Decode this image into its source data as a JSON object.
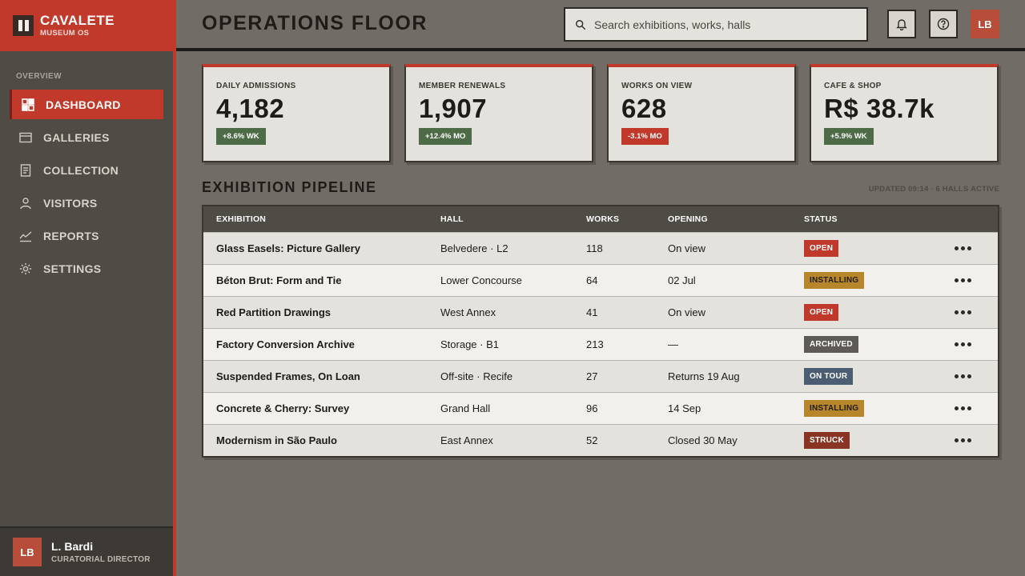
{
  "brand": {
    "name": "CAVALETE",
    "sub": "MUSEUM OS"
  },
  "sidebar": {
    "section_label": "OVERVIEW",
    "items": [
      {
        "label": "DASHBOARD",
        "icon": "dashboard-icon",
        "active": true
      },
      {
        "label": "GALLERIES",
        "icon": "galleries-icon",
        "active": false
      },
      {
        "label": "COLLECTION",
        "icon": "collection-icon",
        "active": false
      },
      {
        "label": "VISITORS",
        "icon": "visitors-icon",
        "active": false
      },
      {
        "label": "REPORTS",
        "icon": "reports-icon",
        "active": false
      },
      {
        "label": "SETTINGS",
        "icon": "settings-icon",
        "active": false
      }
    ]
  },
  "user": {
    "initials": "LB",
    "name": "L. Bardi",
    "role": "CURATORIAL DIRECTOR"
  },
  "header": {
    "title": "OPERATIONS FLOOR",
    "search_placeholder": "Search exhibitions, works, halls",
    "notifications_icon": "bell-icon",
    "help_icon": "help-icon",
    "avatar_initials": "LB"
  },
  "kpis": [
    {
      "label": "DAILY ADMISSIONS",
      "value": "4,182",
      "delta": "+8.6% WK",
      "trend": "up"
    },
    {
      "label": "MEMBER RENEWALS",
      "value": "1,907",
      "delta": "+12.4% MO",
      "trend": "up"
    },
    {
      "label": "WORKS ON VIEW",
      "value": "628",
      "delta": "-3.1% MO",
      "trend": "down"
    },
    {
      "label": "CAFE & SHOP",
      "value": "R$ 38.7k",
      "delta": "+5.9% WK",
      "trend": "up"
    }
  ],
  "pipeline": {
    "title": "EXHIBITION PIPELINE",
    "meta": "UPDATED 09:14 · 6 HALLS ACTIVE",
    "columns": [
      "EXHIBITION",
      "HALL",
      "WORKS",
      "OPENING",
      "STATUS"
    ],
    "rows": [
      {
        "exhibition": "Glass Easels: Picture Gallery",
        "hall": "Belvedere · L2",
        "works": "118",
        "opening": "On view",
        "status": "OPEN"
      },
      {
        "exhibition": "Béton Brut: Form and Tie",
        "hall": "Lower Concourse",
        "works": "64",
        "opening": "02 Jul",
        "status": "INSTALLING"
      },
      {
        "exhibition": "Red Partition Drawings",
        "hall": "West Annex",
        "works": "41",
        "opening": "On view",
        "status": "OPEN"
      },
      {
        "exhibition": "Factory Conversion Archive",
        "hall": "Storage · B1",
        "works": "213",
        "opening": "—",
        "status": "ARCHIVED"
      },
      {
        "exhibition": "Suspended Frames, On Loan",
        "hall": "Off-site · Recife",
        "works": "27",
        "opening": "Returns 19 Aug",
        "status": "ON TOUR"
      },
      {
        "exhibition": "Concrete & Cherry: Survey",
        "hall": "Grand Hall",
        "works": "96",
        "opening": "14 Sep",
        "status": "INSTALLING"
      },
      {
        "exhibition": "Modernism in São Paulo",
        "hall": "East Annex",
        "works": "52",
        "opening": "Closed 30 May",
        "status": "STRUCK"
      }
    ]
  },
  "colors": {
    "accent": "#c0392b",
    "sidebar": "#4f4b45",
    "background": "#716c65",
    "positive": "#4d6b47",
    "installing": "#b8862a",
    "archived": "#5e5a55",
    "on_tour": "#4a5d73",
    "struck": "#8a3424"
  }
}
